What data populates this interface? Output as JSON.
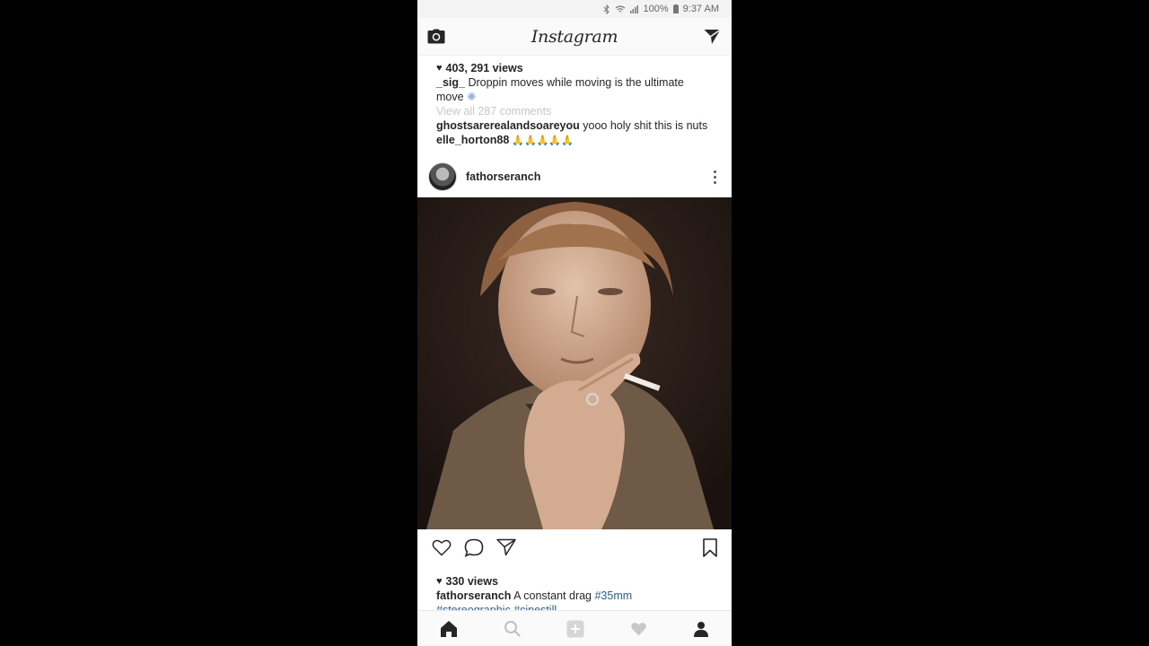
{
  "status_bar": {
    "battery": "100%",
    "time": "9:37 AM"
  },
  "app_bar": {
    "title": "Instagram",
    "left_icon": "camera-icon",
    "right_icon": "direct-send-icon"
  },
  "previous_post": {
    "views": "403, 291 views",
    "caption_user": "_sig_",
    "caption_text": " Droppin moves while moving is the ultimate move",
    "view_comments": "View all 287 comments",
    "comments": [
      {
        "user": "ghostsarerealandsoareyou",
        "text": " yooo holy shit this is nuts"
      },
      {
        "user": "elle_horton88",
        "text": " 🙏🙏🙏🙏🙏"
      }
    ]
  },
  "post": {
    "username": "fathorseranch",
    "image_alt": "photo of a man smoking a cigarette",
    "views": "330 views",
    "caption_user": "fathorseranch",
    "caption_text": " A constant drag ",
    "hashtags": [
      "#35mm",
      "#stereographic",
      "#cinestill"
    ]
  },
  "bottom_nav": [
    "home-icon",
    "search-icon",
    "add-icon",
    "heart-icon",
    "profile-icon"
  ],
  "colors": {
    "hashtag": "#2e5d8c",
    "muted_text": "#c7c7c7",
    "background": "#000000"
  }
}
